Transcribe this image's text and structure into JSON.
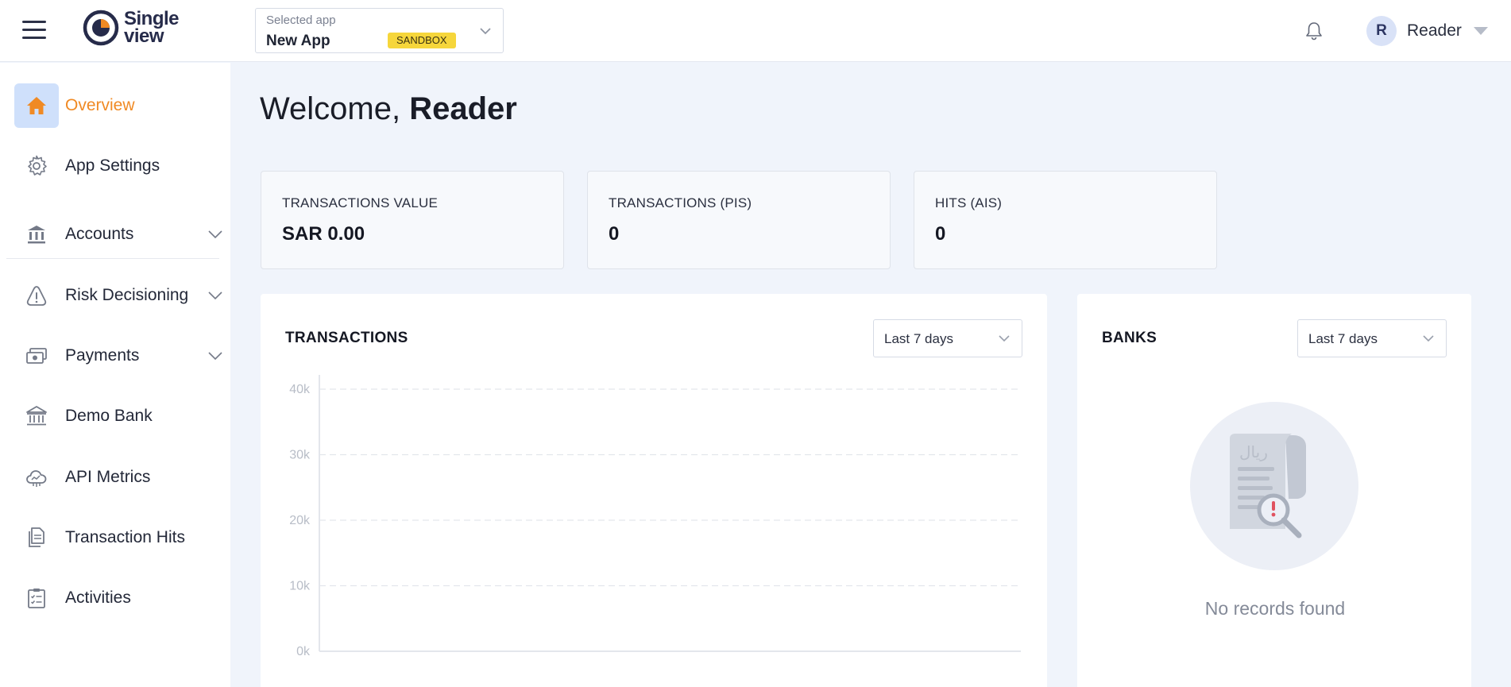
{
  "header": {
    "logo_line1": "Single",
    "logo_line2": "view",
    "selected_app_label": "Selected app",
    "selected_app_name": "New App",
    "env_badge": "SANDBOX",
    "user_initial": "R",
    "user_name": "Reader"
  },
  "sidebar": {
    "items": [
      {
        "label": "Overview",
        "icon": "home-icon",
        "active": true
      },
      {
        "label": "App Settings",
        "icon": "gear-icon"
      },
      {
        "label": "Accounts",
        "icon": "bank-icon",
        "expandable": true
      },
      {
        "label": "Risk Decisioning",
        "icon": "warning-icon",
        "expandable": true
      },
      {
        "label": "Payments",
        "icon": "cash-icon",
        "expandable": true
      },
      {
        "label": "Demo Bank",
        "icon": "demo-bank-icon"
      },
      {
        "label": "API Metrics",
        "icon": "cloud-icon"
      },
      {
        "label": "Transaction Hits",
        "icon": "document-icon"
      },
      {
        "label": "Activities",
        "icon": "clipboard-icon"
      }
    ]
  },
  "main": {
    "welcome_prefix": "Welcome,",
    "welcome_name": "Reader",
    "stats": [
      {
        "title": "TRANSACTIONS VALUE",
        "value": "SAR 0.00"
      },
      {
        "title": "TRANSACTIONS (PIS)",
        "value": "0"
      },
      {
        "title": "HITS (AIS)",
        "value": "0"
      }
    ],
    "transactions_card": {
      "title": "TRANSACTIONS",
      "range": "Last 7 days"
    },
    "banks_card": {
      "title": "BANKS",
      "range": "Last 7 days",
      "empty_text": "No records found"
    }
  },
  "colors": {
    "accent": "#f08a24",
    "active_bg": "#cfe0fb",
    "badge": "#f6d63b",
    "page_bg": "#f0f4fb"
  },
  "chart_data": {
    "type": "line",
    "title": "TRANSACTIONS",
    "y_ticks": [
      "40k",
      "30k",
      "20k",
      "10k",
      "0k"
    ],
    "ylim": [
      0,
      40000
    ],
    "series": [],
    "grid": true
  }
}
